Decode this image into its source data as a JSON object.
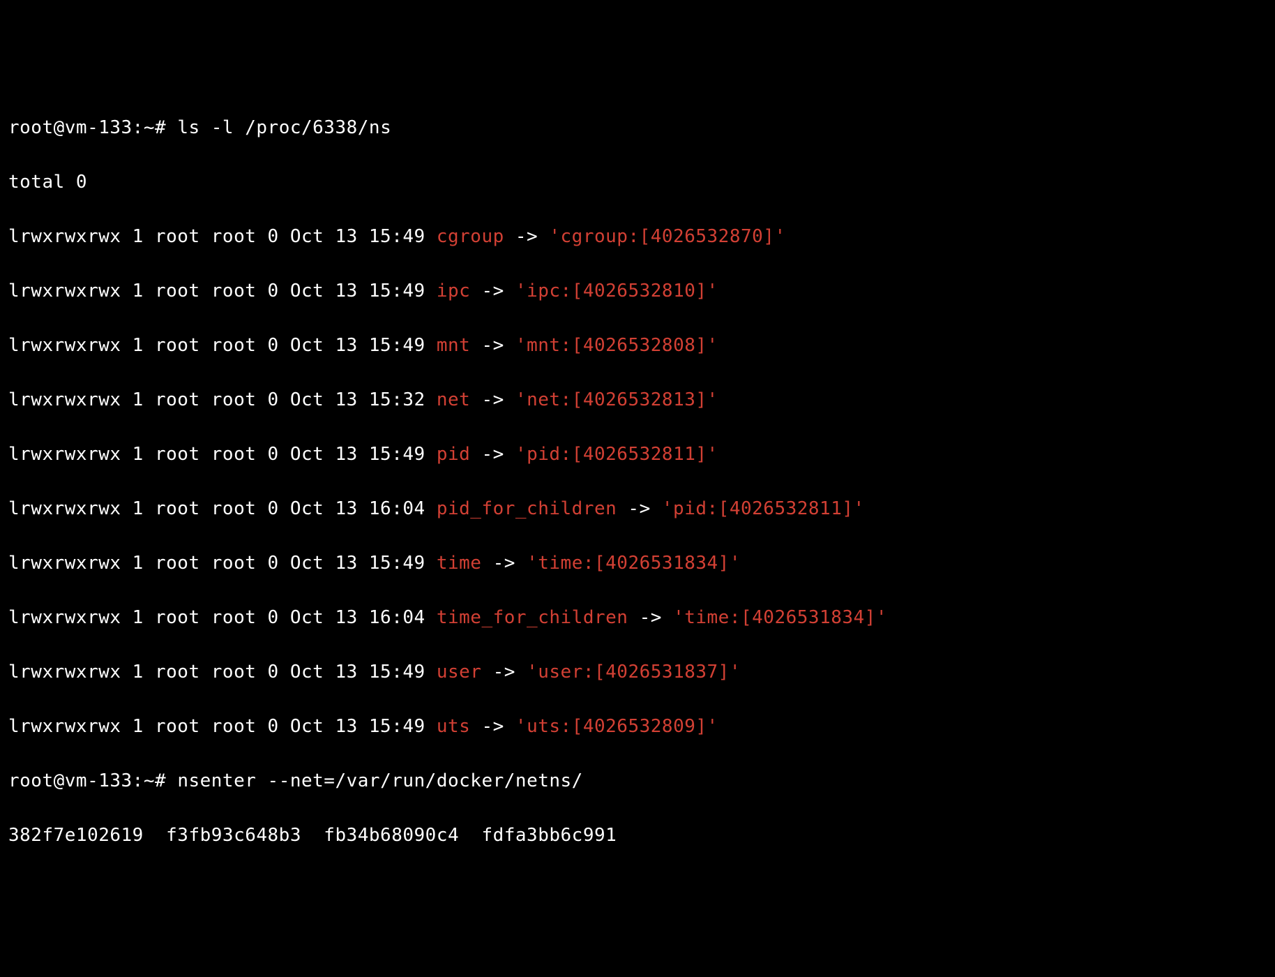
{
  "prompt1": "root@vm-133:~#",
  "cmd1": "ls -l /proc/6338/ns",
  "total_line": "total 0",
  "entries": [
    {
      "meta": "lrwxrwxrwx 1 root root 0 Oct 13 15:49 ",
      "name": "cgroup",
      "arrow": " -> ",
      "target": "'cgroup:[4026532870]'"
    },
    {
      "meta": "lrwxrwxrwx 1 root root 0 Oct 13 15:49 ",
      "name": "ipc",
      "arrow": " -> ",
      "target": "'ipc:[4026532810]'"
    },
    {
      "meta": "lrwxrwxrwx 1 root root 0 Oct 13 15:49 ",
      "name": "mnt",
      "arrow": " -> ",
      "target": "'mnt:[4026532808]'"
    },
    {
      "meta": "lrwxrwxrwx 1 root root 0 Oct 13 15:32 ",
      "name": "net",
      "arrow": " -> ",
      "target": "'net:[4026532813]'"
    },
    {
      "meta": "lrwxrwxrwx 1 root root 0 Oct 13 15:49 ",
      "name": "pid",
      "arrow": " -> ",
      "target": "'pid:[4026532811]'"
    },
    {
      "meta": "lrwxrwxrwx 1 root root 0 Oct 13 16:04 ",
      "name": "pid_for_children",
      "arrow": " -> ",
      "target": "'pid:[4026532811]'"
    },
    {
      "meta": "lrwxrwxrwx 1 root root 0 Oct 13 15:49 ",
      "name": "time",
      "arrow": " -> ",
      "target": "'time:[4026531834]'"
    },
    {
      "meta": "lrwxrwxrwx 1 root root 0 Oct 13 16:04 ",
      "name": "time_for_children",
      "arrow": " -> ",
      "target": "'time:[4026531834]'"
    },
    {
      "meta": "lrwxrwxrwx 1 root root 0 Oct 13 15:49 ",
      "name": "user",
      "arrow": " -> ",
      "target": "'user:[4026531837]'"
    },
    {
      "meta": "lrwxrwxrwx 1 root root 0 Oct 13 15:49 ",
      "name": "uts",
      "arrow": " -> ",
      "target": "'uts:[4026532809]'"
    }
  ],
  "prompt2": "root@vm-133:~#",
  "cmd2": "nsenter --net=/var/run/docker/netns/",
  "completion_line": "382f7e102619  f3fb93c648b3  fb34b68090c4  fdfa3bb6c991"
}
